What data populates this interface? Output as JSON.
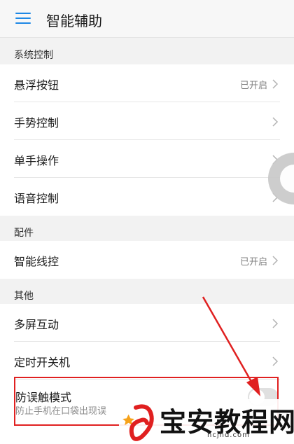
{
  "header": {
    "title": "智能辅助",
    "menu_icon": "hamburger-menu-icon"
  },
  "sections": [
    {
      "title": "系统控制"
    },
    {
      "title": "配件"
    },
    {
      "title": "其他"
    }
  ],
  "items": {
    "floating_button": {
      "label": "悬浮按钮",
      "value": "已开启"
    },
    "gesture_control": {
      "label": "手势控制"
    },
    "one_hand": {
      "label": "单手操作"
    },
    "voice_control": {
      "label": "语音控制"
    },
    "smart_wire": {
      "label": "智能线控",
      "value": "已开启"
    },
    "multi_screen": {
      "label": "多屏互动"
    },
    "scheduled_power": {
      "label": "定时开关机"
    },
    "anti_touch": {
      "label": "防误触模式",
      "subtitle": "防止手机在口袋出现误"
    }
  },
  "watermark": {
    "text": "宝安教程网",
    "url": "hcjhd.com"
  },
  "colors": {
    "accent": "#1e88e5",
    "highlight": "#e02020",
    "value_gray": "#808080"
  }
}
